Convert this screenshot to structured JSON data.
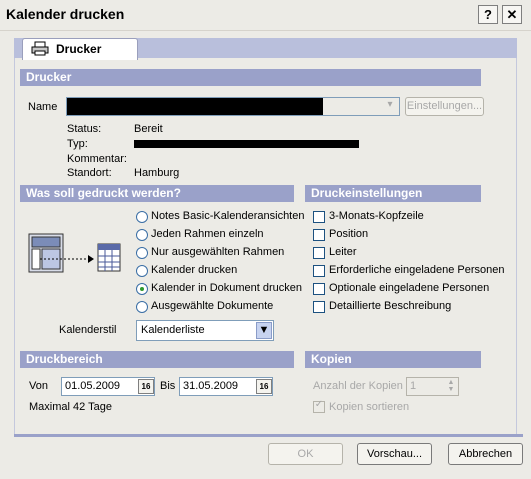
{
  "window": {
    "title": "Kalender drucken",
    "help_label": "?",
    "close_label": "✕"
  },
  "tab": {
    "label": "Drucker",
    "icon": "printer-icon"
  },
  "printer": {
    "header": "Drucker",
    "name_label": "Name",
    "settings_button": "Einstellungen...",
    "status_label": "Status:",
    "status_value": "Bereit",
    "type_label": "Typ:",
    "comment_label": "Kommentar:",
    "location_label": "Standort:",
    "location_value": "Hamburg"
  },
  "what": {
    "header": "Was soll gedruckt werden?",
    "options": [
      "Notes Basic-Kalenderansichten",
      "Jeden Rahmen einzeln",
      "Nur ausgewählten Rahmen",
      "Kalender drucken",
      "Kalender in Dokument drucken",
      "Ausgewählte Dokumente"
    ],
    "selected": "Kalender in Dokument drucken",
    "style_label": "Kalenderstil",
    "style_value": "Kalenderliste"
  },
  "settings": {
    "header": "Druckeinstellungen",
    "options": [
      "3-Monats-Kopfzeile",
      "Position",
      "Leiter",
      "Erforderliche eingeladene Personen",
      "Optionale eingeladene Personen",
      "Detaillierte Beschreibung"
    ]
  },
  "range": {
    "header": "Druckbereich",
    "from_label": "Von",
    "from_value": "01.05.2009",
    "to_label": "Bis",
    "to_value": "31.05.2009",
    "cal_icon_text": "16",
    "max_note": "Maximal 42 Tage"
  },
  "copies": {
    "header": "Kopien",
    "count_label": "Anzahl der Kopien",
    "count_value": "1",
    "sort_label": "Kopien sortieren"
  },
  "buttons": {
    "ok": "OK",
    "preview": "Vorschau...",
    "cancel": "Abbrechen"
  },
  "colors": {
    "section_header": "#9aa1c9",
    "tab_strip": "#b9bfdc",
    "dialog_bg": "#ecebe6"
  }
}
